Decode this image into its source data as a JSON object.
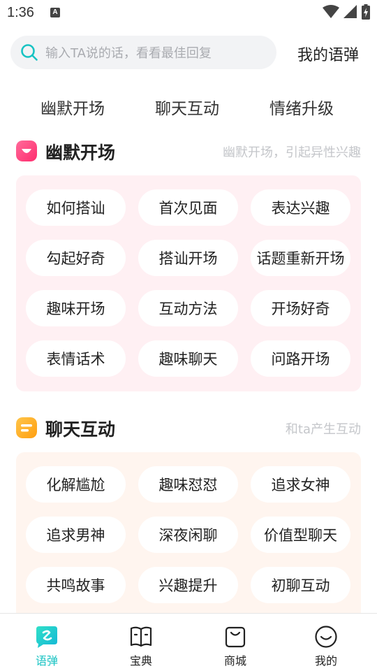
{
  "status_bar": {
    "time": "1:36",
    "notification_letter": "A"
  },
  "search": {
    "placeholder": "输入TA说的话，看看最佳回复",
    "my_phrases_label": "我的语弹"
  },
  "category_tabs": [
    "幽默开场",
    "聊天互动",
    "情绪升级"
  ],
  "sections": [
    {
      "title": "幽默开场",
      "subtitle": "幽默开场，引起异性兴趣",
      "icon": "smile-badge-icon",
      "accent": "#ff3f7a",
      "chips": [
        "如何搭讪",
        "首次见面",
        "表达兴趣",
        "勾起好奇",
        "搭讪开场",
        "话题重新开场",
        "趣味开场",
        "互动方法",
        "开场好奇",
        "表情话术",
        "趣味聊天",
        "问路开场"
      ]
    },
    {
      "title": "聊天互动",
      "subtitle": "和ta产生互动",
      "icon": "chat-lines-icon",
      "accent": "#ffae1f",
      "chips": [
        "化解尴尬",
        "趣味怼怼",
        "追求女神",
        "追求男神",
        "深夜闲聊",
        "价值型聊天",
        "共鸣故事",
        "兴趣提升",
        "初聊互动"
      ]
    }
  ],
  "bottom_nav": [
    {
      "label": "语弹",
      "icon": "chat-bubble-icon",
      "active": true
    },
    {
      "label": "宝典",
      "icon": "book-icon",
      "active": false
    },
    {
      "label": "商城",
      "icon": "shopping-bag-icon",
      "active": false
    },
    {
      "label": "我的",
      "icon": "face-icon",
      "active": false
    }
  ],
  "colors": {
    "accent": "#18c3c3",
    "panel_pink": "#fff0f3",
    "panel_peach": "#fff5ef"
  }
}
